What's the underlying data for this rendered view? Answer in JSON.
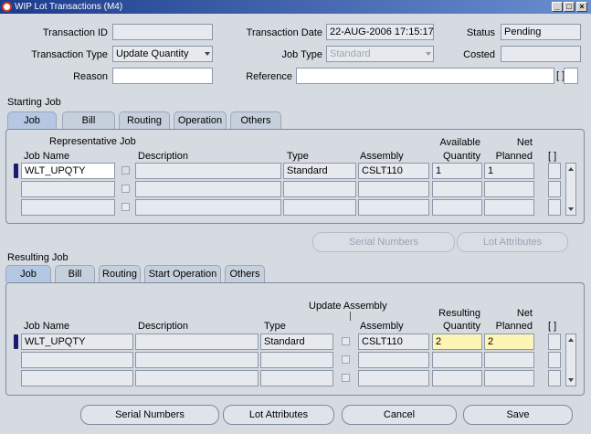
{
  "window": {
    "title": "WIP Lot Transactions (M4)"
  },
  "header": {
    "transaction_id_label": "Transaction ID",
    "transaction_id_value": "",
    "transaction_date_label": "Transaction Date",
    "transaction_date_value": "22-AUG-2006 17:15:17",
    "status_label": "Status",
    "status_value": "Pending",
    "transaction_type_label": "Transaction Type",
    "transaction_type_value": "Update Quantity",
    "job_type_label": "Job Type",
    "job_type_value": "Standard",
    "costed_label": "Costed",
    "costed_value": "",
    "reason_label": "Reason",
    "reason_value": "",
    "reference_label": "Reference",
    "reference_value": "",
    "bracket_text": "[ ]"
  },
  "starting_job": {
    "title": "Starting Job",
    "tabs": [
      "Job",
      "Bill",
      "Routing",
      "Operation",
      "Others"
    ],
    "representative_job_label": "Representative Job",
    "columns": {
      "job_name": "Job Name",
      "description": "Description",
      "type": "Type",
      "assembly": "Assembly",
      "available_1": "Available",
      "available_2": "Quantity",
      "net_1": "Net",
      "net_2": "Planned",
      "bracket": "[ ]"
    },
    "row": {
      "job_name": "WLT_UPQTY",
      "description": "",
      "type": "Standard",
      "assembly": "CSLT110",
      "available_quantity": "1",
      "net_planned": "1"
    },
    "buttons": {
      "serial_numbers": "Serial Numbers",
      "lot_attributes": "Lot Attributes"
    }
  },
  "resulting_job": {
    "title": "Resulting Job",
    "tabs": [
      "Job",
      "Bill",
      "Routing",
      "Start Operation",
      "Others"
    ],
    "update_assembly_label": "Update Assembly",
    "columns": {
      "job_name": "Job Name",
      "description": "Description",
      "type": "Type",
      "assembly": "Assembly",
      "resulting_1": "Resulting",
      "resulting_2": "Quantity",
      "net_1": "Net",
      "net_2": "Planned",
      "bracket": "[ ]"
    },
    "row": {
      "job_name": "WLT_UPQTY",
      "description": "",
      "type": "Standard",
      "assembly": "CSLT110",
      "resulting_quantity": "2",
      "net_planned": "2"
    }
  },
  "footer": {
    "serial_numbers": "Serial Numbers",
    "lot_attributes": "Lot Attributes",
    "cancel": "Cancel",
    "save": "Save"
  }
}
